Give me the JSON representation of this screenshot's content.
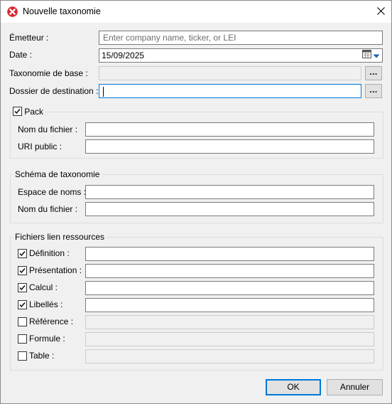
{
  "window": {
    "title": "Nouvelle taxonomie",
    "close_symbol": "✕"
  },
  "form": {
    "issuer": {
      "label": "Émetteur :",
      "value": "",
      "placeholder": "Enter company name, ticker, or LEI"
    },
    "date": {
      "label": "Date :",
      "value": "15/09/2025"
    },
    "base_taxonomy": {
      "label": "Taxonomie de base :",
      "value": "",
      "browse_label": "..."
    },
    "destination_folder": {
      "label": "Dossier de destination :",
      "value": "",
      "browse_label": "..."
    }
  },
  "pack": {
    "label": "Pack",
    "checked": true,
    "file_name": {
      "label": "Nom du fichier :",
      "value": ""
    },
    "public_uri": {
      "label": "URI public :",
      "value": ""
    }
  },
  "schema": {
    "title": "Schéma de taxonomie",
    "namespace": {
      "label": "Espace de noms :",
      "value": ""
    },
    "file_name": {
      "label": "Nom du fichier :",
      "value": ""
    }
  },
  "linkbases": {
    "title": "Fichiers lien ressources",
    "items": [
      {
        "label": "Définition :",
        "checked": true,
        "value": ""
      },
      {
        "label": "Présentation :",
        "checked": true,
        "value": ""
      },
      {
        "label": "Calcul :",
        "checked": true,
        "value": ""
      },
      {
        "label": "Libellés :",
        "checked": true,
        "value": ""
      },
      {
        "label": "Référence :",
        "checked": false,
        "value": ""
      },
      {
        "label": "Formule :",
        "checked": false,
        "value": ""
      },
      {
        "label": "Table :",
        "checked": false,
        "value": ""
      }
    ]
  },
  "buttons": {
    "ok": "OK",
    "cancel": "Annuler"
  },
  "colors": {
    "accent": "#0078d7",
    "app_icon": "#d9262f",
    "dialog_bg": "#f0f0f0"
  }
}
